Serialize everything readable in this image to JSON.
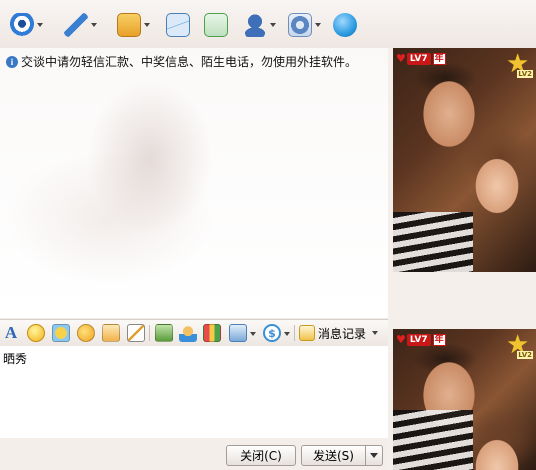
{
  "toolbar": {
    "items": [
      {
        "name": "video-call",
        "color": "#2f7bd6",
        "has_menu": true
      },
      {
        "name": "voice-call",
        "color": "#3b7fd0",
        "has_menu": true
      },
      {
        "name": "send-file",
        "color": "#e8a12a",
        "has_menu": true
      },
      {
        "name": "send-sms",
        "color": "#5b9fe0",
        "has_menu": false
      },
      {
        "name": "create-discussion",
        "color": "#4aa34a",
        "has_menu": false
      },
      {
        "name": "remote-assistance",
        "color": "#3f6fb8",
        "has_menu": true
      },
      {
        "name": "app-center",
        "color": "#5a86c2",
        "has_menu": true
      },
      {
        "name": "switch-app",
        "color": "#2b9be0",
        "has_menu": false
      }
    ]
  },
  "chat": {
    "notice": "交谈中请勿轻信汇款、中奖信息、陌生电话，勿使用外挂软件。"
  },
  "input_toolbar": {
    "history_label": "消息记录"
  },
  "input": {
    "text": "晒秀"
  },
  "buttons": {
    "close": "关闭(C)",
    "send": "发送(S)"
  },
  "profile": {
    "level_badge": "LV7",
    "year_badge": "年",
    "star_badge": "LV2"
  }
}
